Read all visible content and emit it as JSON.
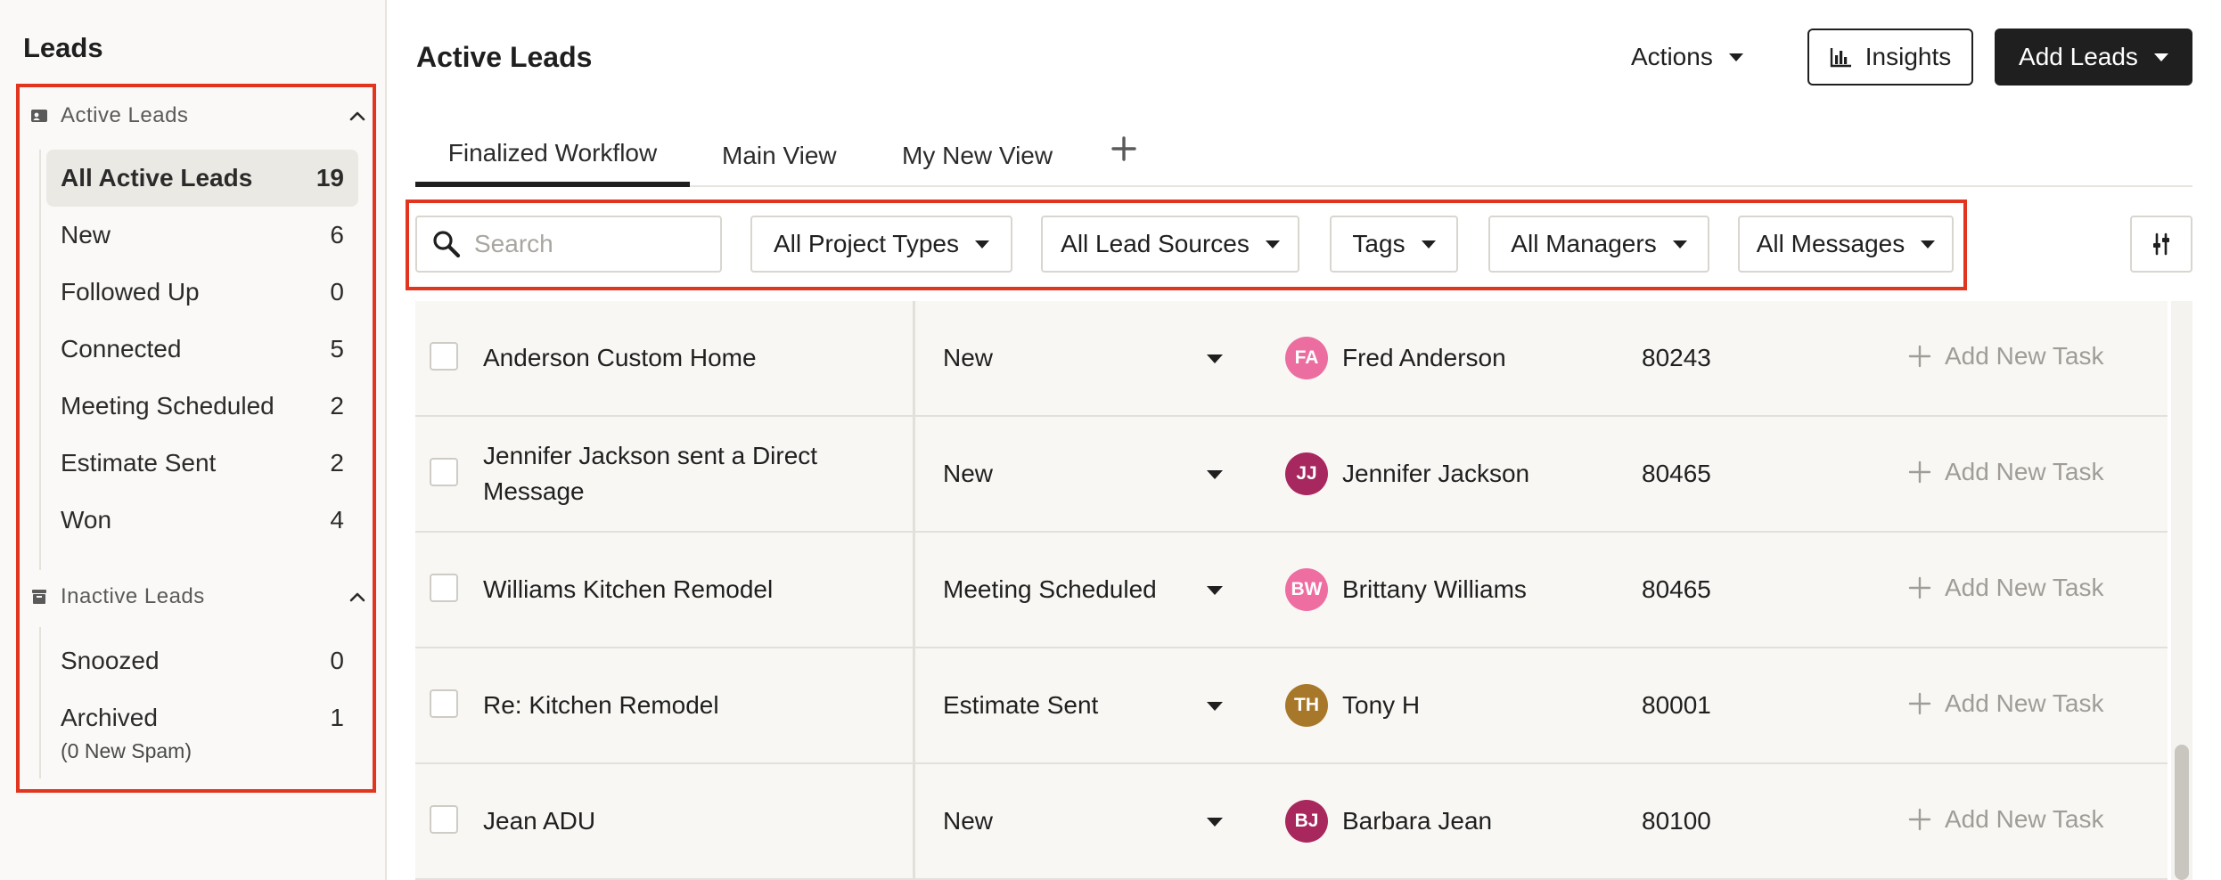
{
  "sidebar": {
    "title": "Leads",
    "active_section": {
      "label": "Active Leads",
      "items": [
        {
          "label": "All Active Leads",
          "count": "19"
        },
        {
          "label": "New",
          "count": "6"
        },
        {
          "label": "Followed Up",
          "count": "0"
        },
        {
          "label": "Connected",
          "count": "5"
        },
        {
          "label": "Meeting Scheduled",
          "count": "2"
        },
        {
          "label": "Estimate Sent",
          "count": "2"
        },
        {
          "label": "Won",
          "count": "4"
        }
      ]
    },
    "inactive_section": {
      "label": "Inactive Leads",
      "items": [
        {
          "label": "Snoozed",
          "count": "0"
        },
        {
          "label": "Archived",
          "count": "1",
          "sub": "(0 New Spam)"
        }
      ]
    }
  },
  "header": {
    "title": "Active Leads",
    "actions_label": "Actions",
    "insights_label": "Insights",
    "add_leads_label": "Add Leads"
  },
  "tabs": [
    {
      "label": "Finalized Workflow",
      "active": true
    },
    {
      "label": "Main View"
    },
    {
      "label": "My New View"
    }
  ],
  "filters": {
    "search_placeholder": "Search",
    "project_types": "All Project Types",
    "lead_sources": "All Lead Sources",
    "tags": "Tags",
    "managers": "All Managers",
    "messages": "All Messages"
  },
  "rows": [
    {
      "name": "Anderson Custom Home",
      "status": "New",
      "initials": "FA",
      "avatar_color": "#ec6ea0",
      "manager": "Fred Anderson",
      "zip": "80243",
      "task": "Add New Task"
    },
    {
      "name": "Jennifer Jackson sent a Direct Message",
      "status": "New",
      "initials": "JJ",
      "avatar_color": "#a7275f",
      "manager": "Jennifer Jackson",
      "zip": "80465",
      "task": "Add New Task"
    },
    {
      "name": "Williams Kitchen Remodel",
      "status": "Meeting Scheduled",
      "initials": "BW",
      "avatar_color": "#ee6ea2",
      "manager": "Brittany Williams",
      "zip": "80465",
      "task": "Add New Task"
    },
    {
      "name": "Re: Kitchen Remodel",
      "status": "Estimate Sent",
      "initials": "TH",
      "avatar_color": "#a8782a",
      "manager": "Tony H",
      "zip": "80001",
      "task": "Add New Task"
    },
    {
      "name": "Jean ADU",
      "status": "New",
      "initials": "BJ",
      "avatar_color": "#a8285e",
      "manager": "Barbara Jean",
      "zip": "80100",
      "task": "Add New Task"
    }
  ],
  "colors": {
    "highlight_border": "#e1351f",
    "primary_dark": "#1f1f1f"
  }
}
